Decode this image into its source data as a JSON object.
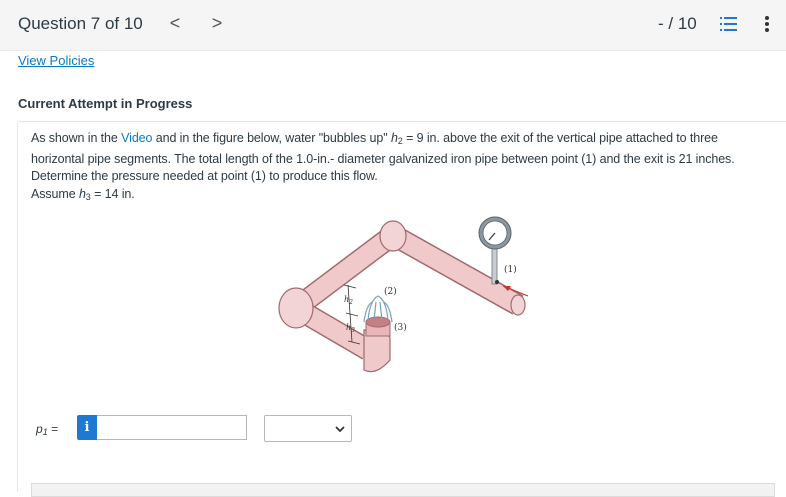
{
  "header": {
    "question_title": "Question 7 of 10",
    "prev_glyph": "<",
    "next_glyph": ">",
    "score": "- / 10",
    "icons": [
      "question-list-icon",
      "more-options-icon"
    ]
  },
  "links": {
    "view_policies": "View Policies"
  },
  "attempt_status": "Current Attempt in Progress",
  "problem": {
    "part1": "As shown in the ",
    "video_link": "Video",
    "part2": " and in the figure below, water \"bubbles up\" ",
    "h2_var": "h",
    "h2_sub": "2",
    "part3": " = 9 in. above the exit of the vertical pipe attached to three horizontal pipe segments. The total length of the 1.0-in.- diameter galvanized iron pipe between point (1) and the exit is 21 inches. Determine the pressure needed at point (1) to produce this flow.",
    "assume_prefix": "Assume ",
    "h3_var": "h",
    "h3_sub": "3",
    "assume_suffix": " = 14 in."
  },
  "figure": {
    "labels": {
      "point1": "(1)",
      "point2": "(2)",
      "point3": "(3)",
      "h2": "h",
      "h2_sub": "2",
      "h3": "h",
      "h3_sub": "3"
    }
  },
  "answer": {
    "var": "p",
    "sub": "1",
    "equals": " =",
    "info_glyph": "i",
    "value": "",
    "unit_selected": ""
  },
  "colors": {
    "accent": "#1f79d3",
    "link": "#0b7bc1",
    "pipe": "#f0c9cb"
  }
}
